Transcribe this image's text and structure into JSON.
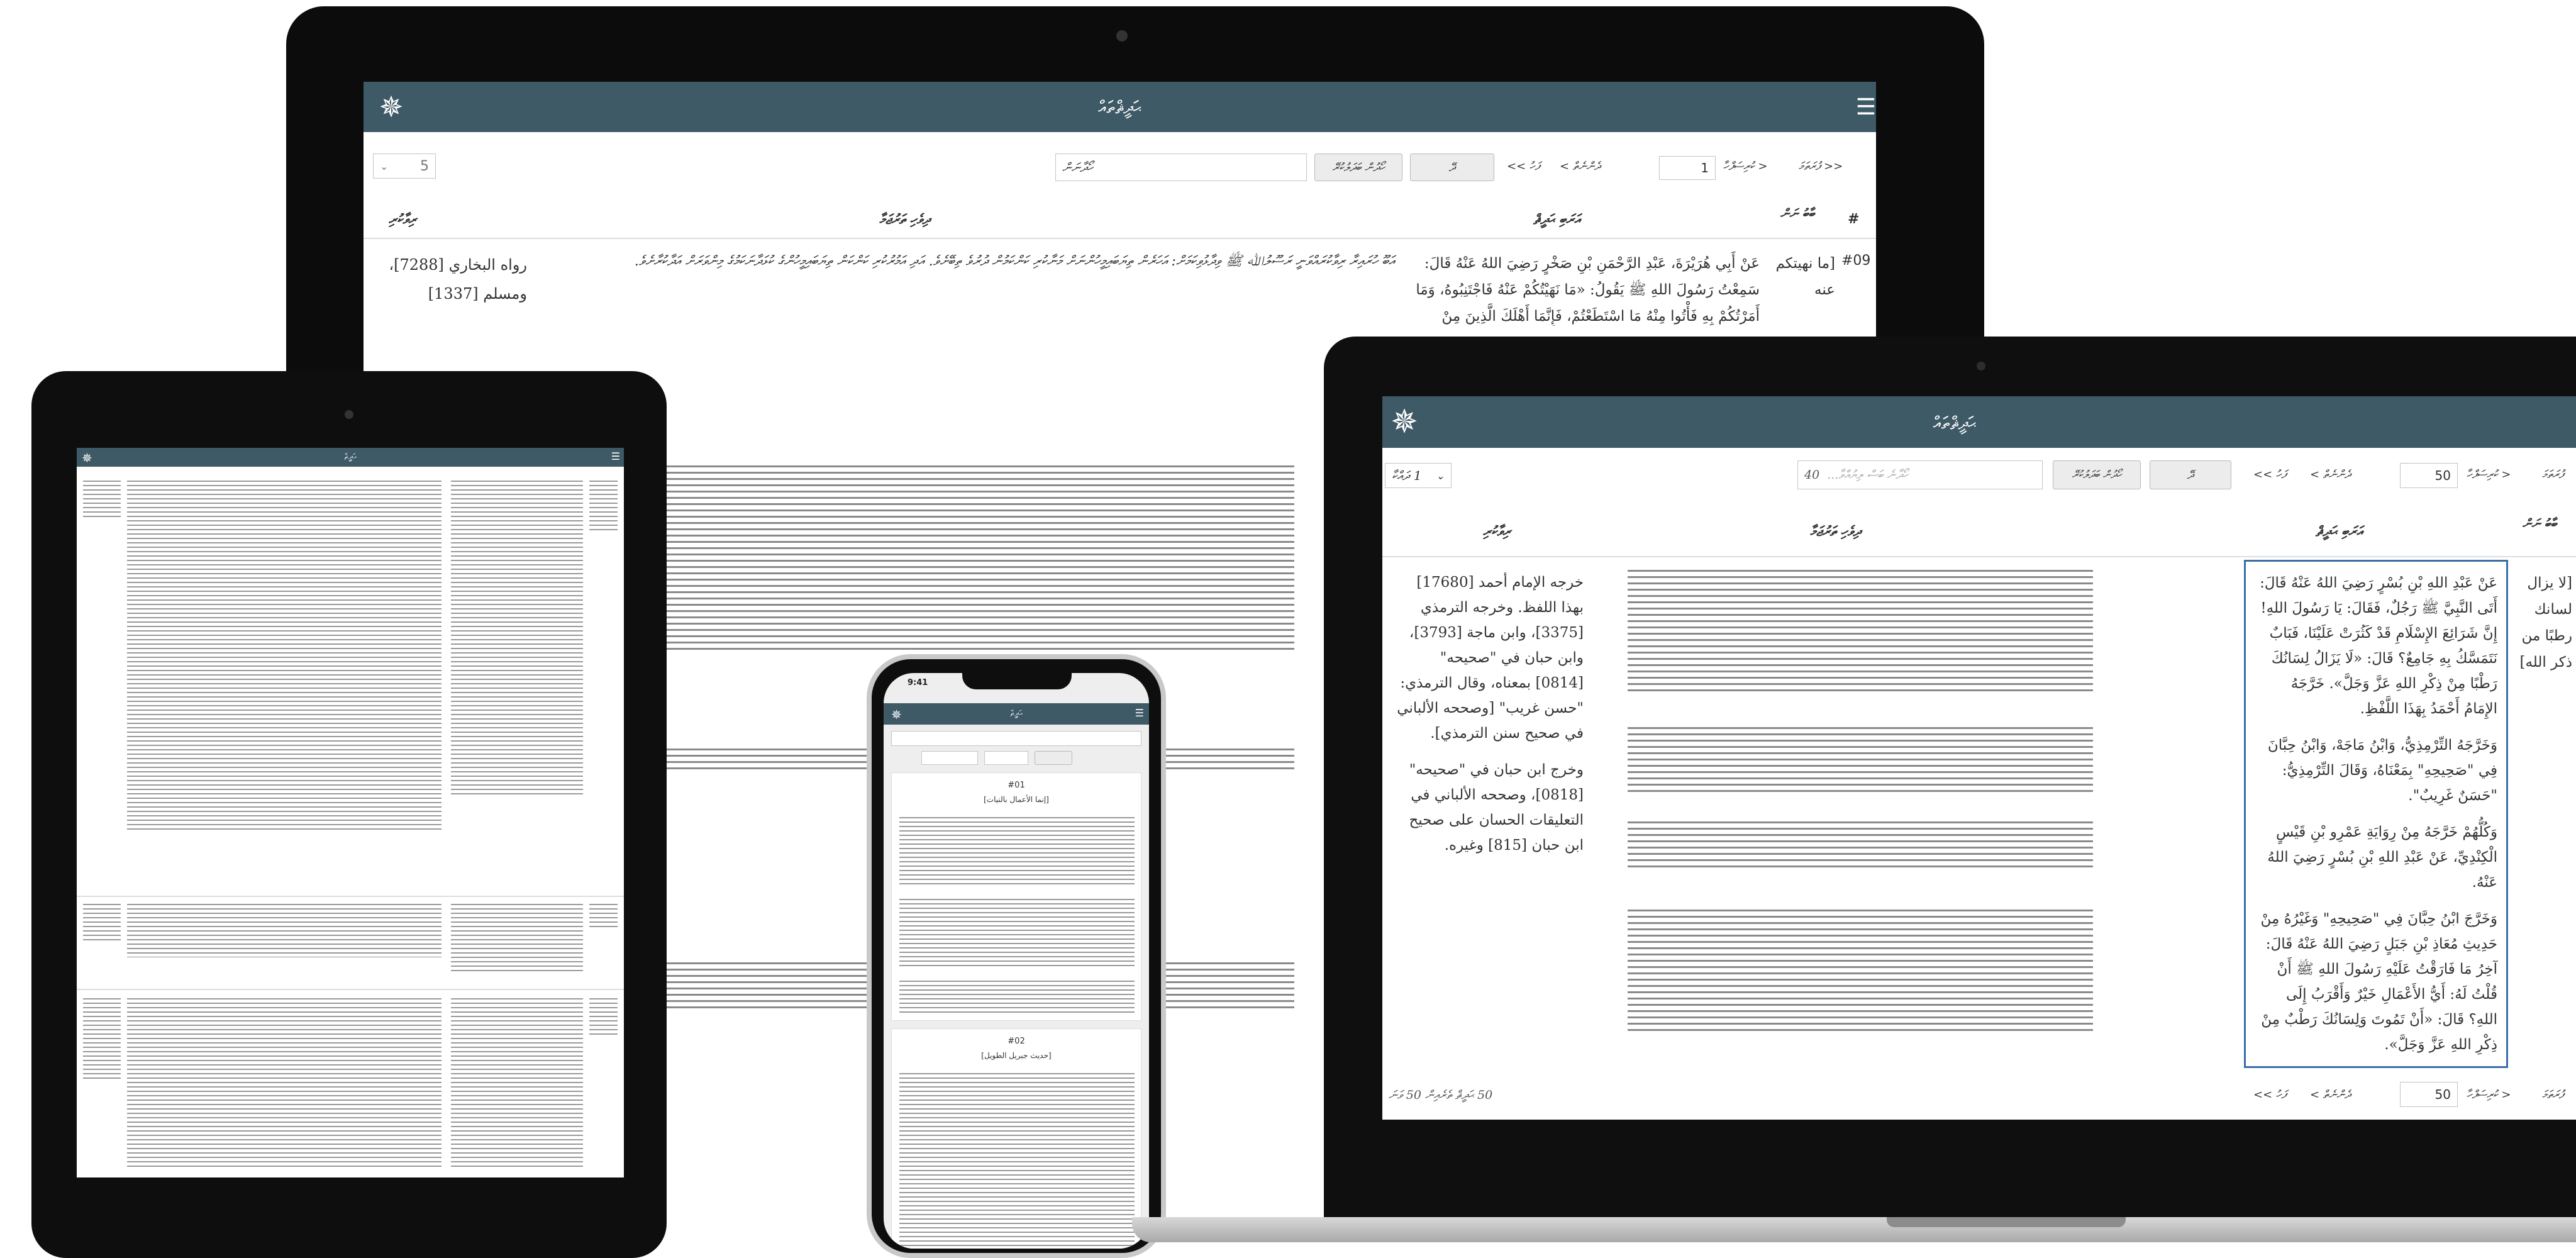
{
  "app": {
    "title": "ޙަދީޘްތައް"
  },
  "desktop": {
    "nav": {
      "first": "<< ފުރަތަމަ",
      "prev": "< ކުރިސަފްހާ",
      "page_value": "1",
      "next": "ދެންނެތް >",
      "last": "ފަހު >>",
      "go_btn": "ދޭ",
      "search_btn": "ހޯދުން ބަދަލުކުރޭ",
      "search_placeholder": "ހޯދާނަން",
      "per_page": "5"
    },
    "headers": {
      "num": "#",
      "title": "ބާބު ނަން",
      "arabic": "އަރަބި ޙަދީޘް",
      "dhivehi": "ދިވެހި ތަރުޖަމާ",
      "source": "ރިވާކުރި"
    },
    "row": {
      "num": "#09",
      "title_text": "[ما نهيتكم عنه",
      "arabic_text": "عَنْ أَبِي هُرَيْرَةَ، عَبْدِ الرَّحْمَنِ بْنِ صَخْرٍ رَضِيَ اللهُ عَنْهُ قَالَ: سَمِعْتُ رَسُولَ اللهِ ﷺ يَقُولُ: «مَا نَهَيْتُكُمْ عَنْهُ فَاجْتَنِبُوهُ، وَمَا أَمَرْتُكُمْ بِهِ فَأْتُوا مِنْهُ مَا اسْتَطَعْتُمْ، فَإِنَّمَا أَهْلَكَ الَّذِينَ مِنْ قَبْلِكُمْ كَثْرَةُ",
      "dhivehi_text": "އަބޫ ހުރައިރާ ރިވާކުރައްވަނީ ރަސޫލުﷲ ﷺ ވިދާޅުވިކަމަށް: އަހަރެން ތިޔަބައިމީހުންނަށް މަނާކުރި ކަންކަމުން ދުރުވެ ތިބޭށެވެ. އަދި އަމުރުކުރި ކަންކަން ތިޔަބައިމީހުންގެ ކުޅަދާނަކަމުގެ މިންވަރަށް އަދާކުރާށެވެ.",
      "source_text": "رواه البخاري [7288]، ومسلم [1337]"
    }
  },
  "laptop": {
    "nav": {
      "first": "ފުރަތަމަ",
      "prev": "< ކުރިސަފްހާ",
      "page_value": "50",
      "next": "ދެންނެތް >",
      "last": "ފަހު >>",
      "go_btn": "ދޭ",
      "search_btn": "ހޯދުން ބަދަލުކުރޭ",
      "search_value": "40",
      "search_placeholder": "ހޯދާނެ ބަސް ލިޔުއްވާ...",
      "per_page": "1 ދައްކާ"
    },
    "headers": {
      "title": "ބާބު ނަން",
      "arabic": "އަރަބި ޙަދީޘް",
      "dhivehi": "ދިވެހި ތަރުޖަމާ",
      "source": "ރިވާކުރި"
    },
    "title_col": "[لا يزال لسانك رطبًا من ذكر الله]",
    "arabic_paras": [
      "عَنْ عَبْدِ اللهِ بْنِ بُسْرٍ رَضِيَ اللهُ عَنْهُ قَالَ: أَتَى النَّبِيَّ ﷺ رَجُلٌ، فَقَالَ: يَا رَسُولَ اللهِ! إِنَّ شَرَائِعَ الإِسْلَامِ قَدْ كَثُرَتْ عَلَيْنَا، فَبَابٌ نَتَمَسَّكُ بِهِ جَامِعٌ؟ قَالَ: «لَا يَزَالُ لِسَانُكَ رَطْبًا مِنْ ذِكْرِ اللهِ عَزَّ وَجَلَّ». خَرَّجَهُ الإِمَامُ أَحْمَدُ بِهَذَا اللَّفْظِ.",
      "وَخَرَّجَهُ التِّرْمِذِيُّ، وَابْنُ مَاجَهْ، وَابْنُ حِبَّانَ فِي \"صَحِيحِهِ\" بِمَعْنَاهُ، وَقَالَ التِّرْمِذِيُّ: \"حَسَنٌ غَرِيبٌ\".",
      "وَكُلُّهُمْ خَرَّجَهُ مِنْ رِوَايَةِ عَمْرِو بْنِ قَيْسٍ الْكِنْدِيِّ، عَنْ عَبْدِ اللهِ بْنِ بُسْرٍ رَضِيَ اللهُ عَنْهُ.",
      "وَخَرَّجَ ابْنُ حِبَّانَ فِي \"صَحِيحِهِ\" وَغَيْرُهُ مِنْ حَدِيثِ مُعَاذِ بْنِ جَبَلٍ رَضِيَ اللهُ عَنْهُ قَالَ: آخِرُ مَا فَارَقْتُ عَلَيْهِ رَسُولَ اللهِ ﷺ أَنْ قُلْتُ لَهُ: أَيُّ الأَعْمَالِ خَيْرٌ وَأَقْرَبُ إِلَى اللهِ؟ قَالَ: «أَنْ تَمُوتَ وَلِسَانُكَ رَطْبٌ مِنْ ذِكْرِ اللهِ عَزَّ وَجَلَّ»."
    ],
    "source_paras": [
      "خرجه الإمام أحمد [17680] بهذا اللفظ. وخرجه الترمذي [3375]، وابن ماجة [3793]، وابن حبان في \"صحيحه\" [0814] بمعناه، وقال الترمذي: \"حسن غريب\" [وصححه الألباني في صحيح سنن الترمذي].",
      "وخرج ابن حبان في \"صحيحه\" [0818]، وصححه الألباني في التعليقات الحسان على صحيح ابن حبان [815] وغيره."
    ],
    "footer": {
      "first": "ފުރަތަމަ",
      "prev": "< ކުރިސަފްހާ",
      "page_value": "50",
      "next": "ދެންނެތް >",
      "last": "ފަހު >>",
      "total": "50 ޙަދީޘް ތެރެއިން 50 ވަނަ"
    }
  },
  "tablet": {
    "title": "ޙަދީޘް"
  },
  "phone": {
    "time": "9:41",
    "title": "ޙަދީޘް",
    "cards": [
      {
        "num": "#01",
        "subtitle": "[إنما الأعمال بالنيات]"
      },
      {
        "num": "#02",
        "subtitle": "[حديث جبريل الطويل]"
      }
    ]
  },
  "colors": {
    "brand": "#3e5a66",
    "highlight": "#c7dcf0",
    "selected_border": "#3a6ea5"
  }
}
